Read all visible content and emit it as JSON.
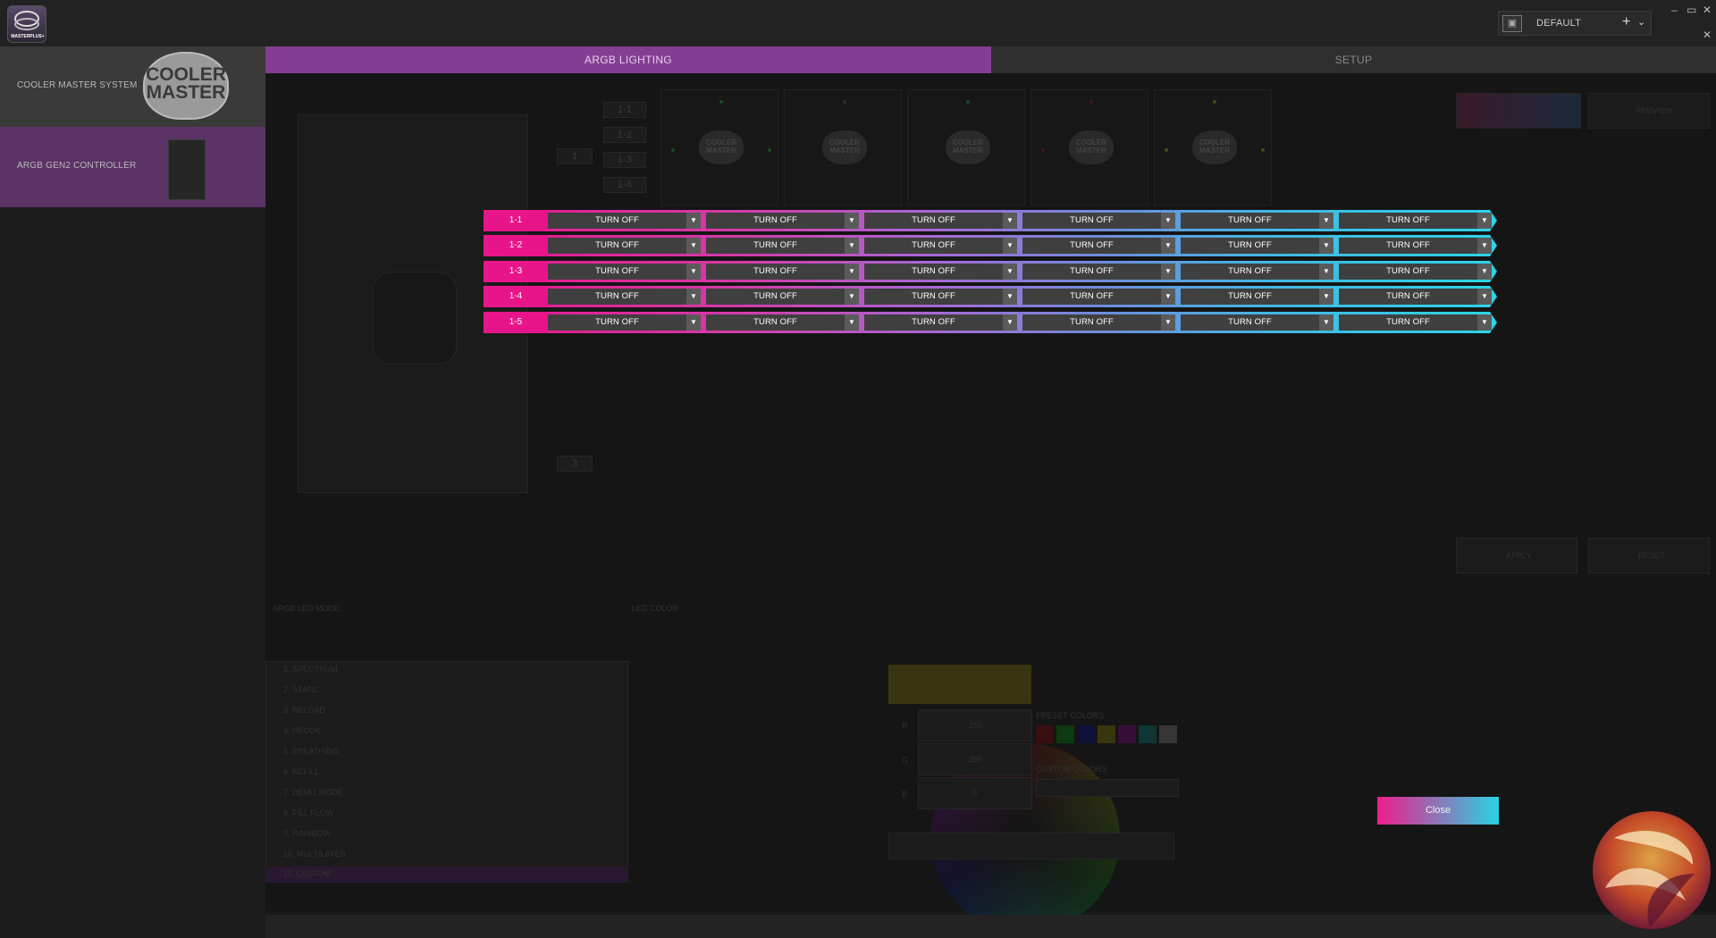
{
  "app": {
    "logo_label": "MASTERPLUS+"
  },
  "profile": {
    "name": "DEFAULT",
    "add": "+",
    "dropdown": "⌄"
  },
  "window_controls": {
    "minimize": "–",
    "restore": "▭",
    "close": "✕",
    "unpin": "✕"
  },
  "sidebar": {
    "items": [
      {
        "label": "COOLER MASTER SYSTEM",
        "logo": "COOLER MASTER"
      },
      {
        "label": "ARGB GEN2 CONTROLLER"
      }
    ]
  },
  "tabs": [
    {
      "label": "ARGB LIGHTING"
    },
    {
      "label": "SETUP"
    }
  ],
  "background": {
    "ports": [
      "1-1",
      "1-2",
      "1-3",
      "1-4",
      "1-5",
      "1",
      "3"
    ],
    "mode_header": "ARGB LED MODE",
    "color_header": "LED COLOR",
    "modes": [
      "1. SPECTRUM",
      "2. STATIC",
      "3. RELOAD",
      "4. RECOIL",
      "5. BREATHING",
      "6. REFILL",
      "7. DEMO MODE",
      "8. FILL FLOW",
      "9. RAINBOW",
      "10. MULTILAYER",
      "11. CUSTOM"
    ],
    "rgb_labels": [
      "R",
      "G",
      "B"
    ],
    "rgb_values": [
      "255",
      "255",
      "0"
    ],
    "preset_label": "PRESET COLORS",
    "custom_label": "CUSTOM COLORS",
    "apply": "APPLY",
    "reset": "RESET",
    "preview_btn": "PREVIEW",
    "fan_logo": "COOLER MASTER"
  },
  "argb_rows": [
    {
      "label": "1-1",
      "options": [
        "TURN OFF",
        "TURN OFF",
        "TURN OFF",
        "TURN OFF",
        "TURN OFF",
        "TURN OFF"
      ]
    },
    {
      "label": "1-2",
      "options": [
        "TURN OFF",
        "TURN OFF",
        "TURN OFF",
        "TURN OFF",
        "TURN OFF",
        "TURN OFF"
      ]
    },
    {
      "label": "1-3",
      "options": [
        "TURN OFF",
        "TURN OFF",
        "TURN OFF",
        "TURN OFF",
        "TURN OFF",
        "TURN OFF"
      ]
    },
    {
      "label": "1-4",
      "options": [
        "TURN OFF",
        "TURN OFF",
        "TURN OFF",
        "TURN OFF",
        "TURN OFF",
        "TURN OFF"
      ]
    },
    {
      "label": "1-5",
      "options": [
        "TURN OFF",
        "TURN OFF",
        "TURN OFF",
        "TURN OFF",
        "TURN OFF",
        "TURN OFF"
      ]
    }
  ],
  "close_button": "Close",
  "colors": {
    "accent": "#843d92",
    "pink": "#e8158a",
    "cyan": "#2bd5e6"
  }
}
